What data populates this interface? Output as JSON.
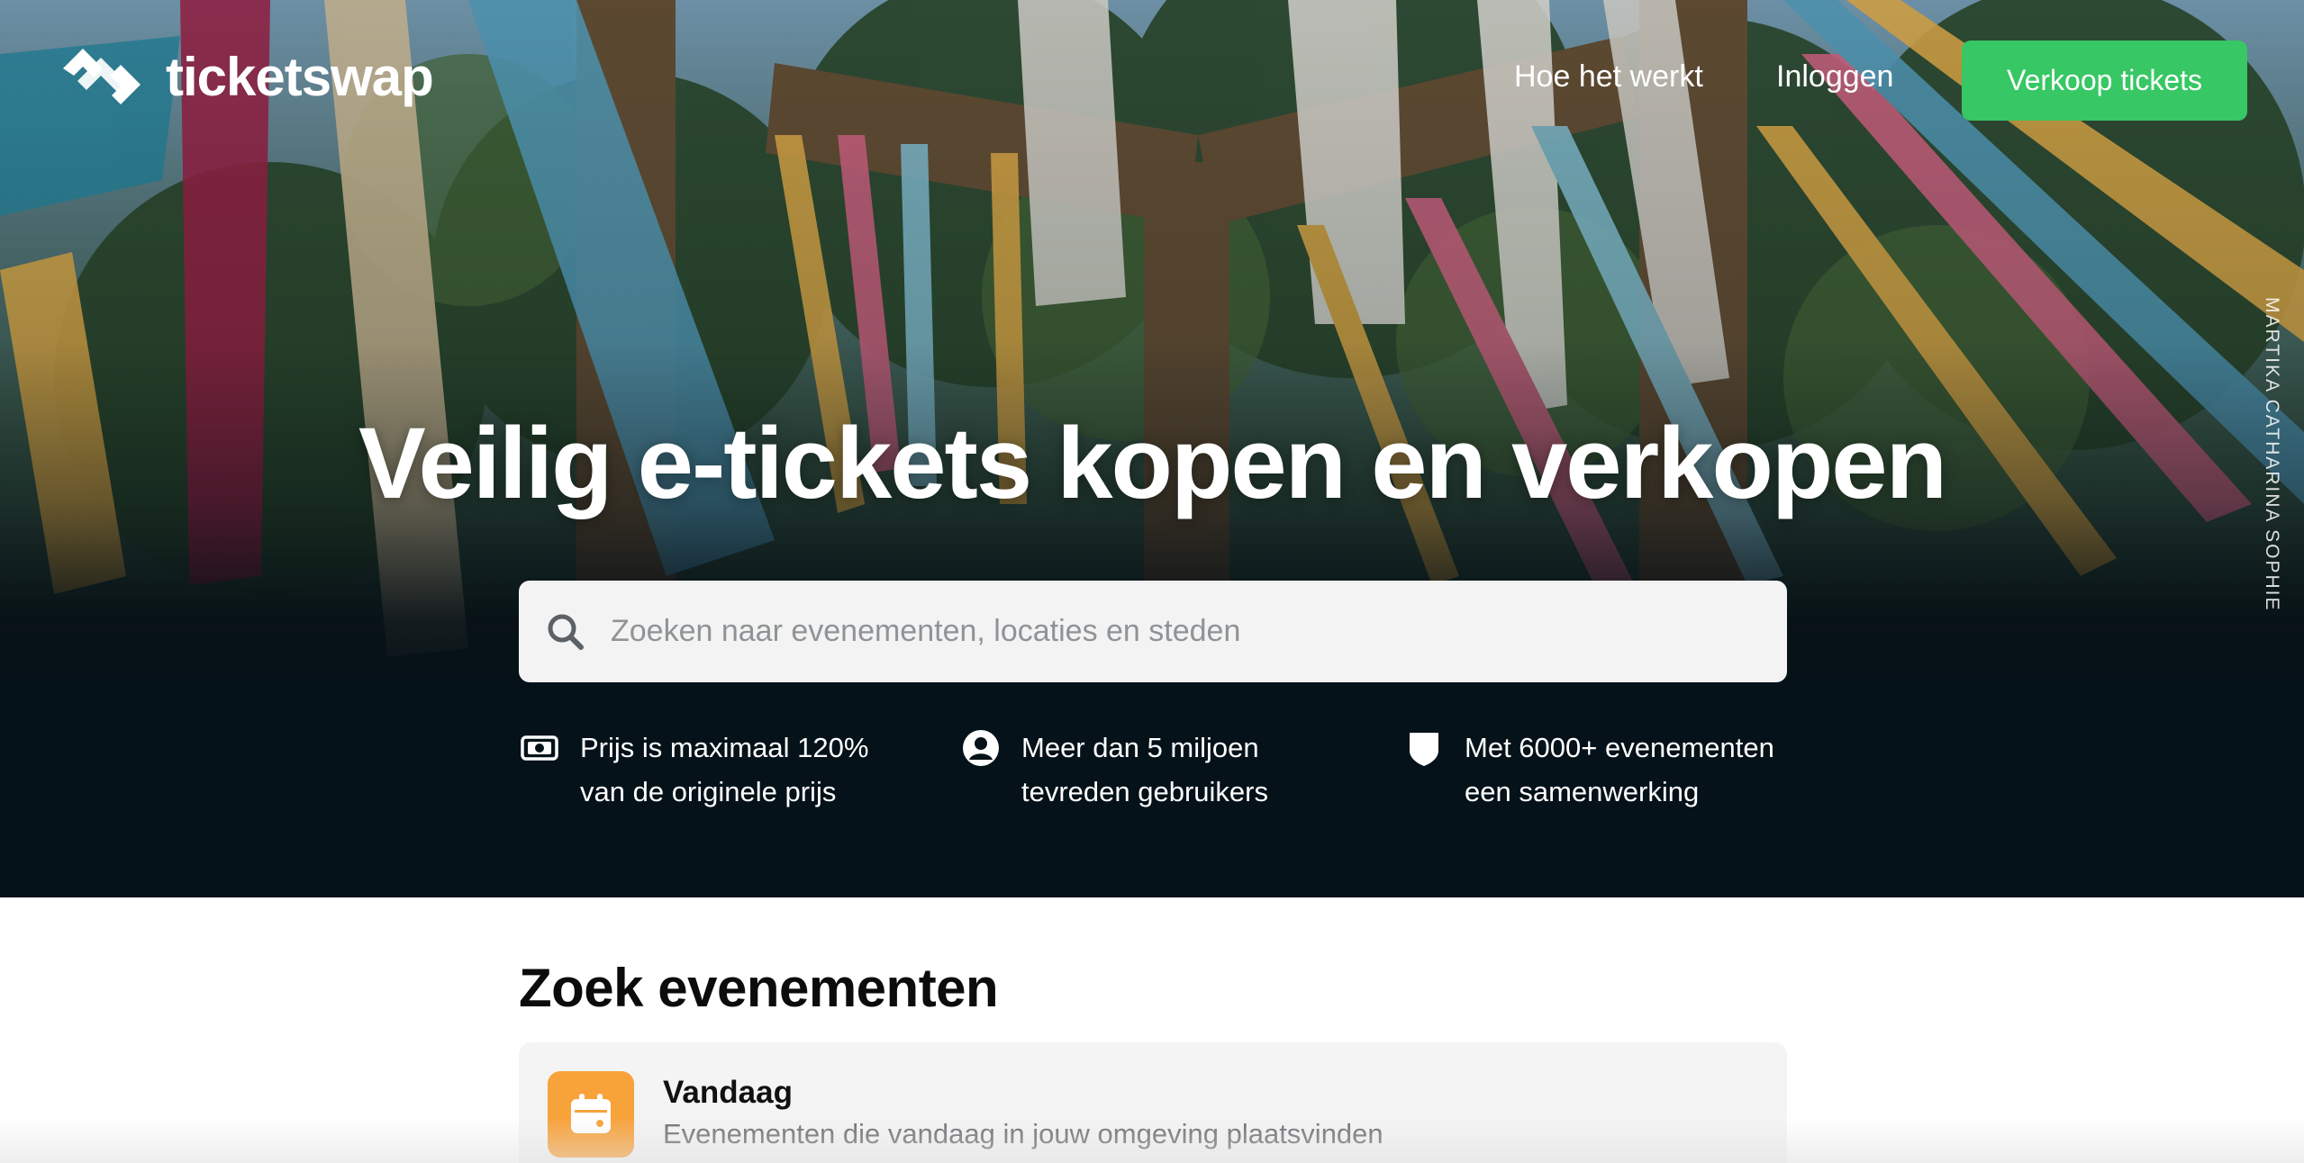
{
  "header": {
    "logo_text": "ticketswap",
    "nav": {
      "how_it_works": "Hoe het werkt",
      "login": "Inloggen",
      "sell_button": "Verkoop tickets"
    }
  },
  "hero": {
    "photo_credit": "MARTIKA CATHARINA SOPHIE",
    "headline": "Veilig e-tickets kopen en verkopen",
    "search": {
      "placeholder": "Zoeken naar evenementen, locaties en steden",
      "value": ""
    },
    "features": [
      {
        "icon": "banknote-icon",
        "text": "Prijs is maximaal 120% van de originele prijs"
      },
      {
        "icon": "user-circle-icon",
        "text": "Meer dan 5 miljoen tevreden gebruikers"
      },
      {
        "icon": "shield-icon",
        "text": "Met 6000+ evenementen een samenwerking"
      }
    ]
  },
  "events_section": {
    "title": "Zoek evenementen",
    "cards": [
      {
        "icon": "calendar-icon",
        "title": "Vandaag",
        "subtitle": "Evenementen die vandaag in jouw omgeving plaatsvinden"
      }
    ]
  },
  "colors": {
    "accent_green": "#37c764",
    "hero_dark": "#061219",
    "calendar_orange": "#f8a23a"
  }
}
